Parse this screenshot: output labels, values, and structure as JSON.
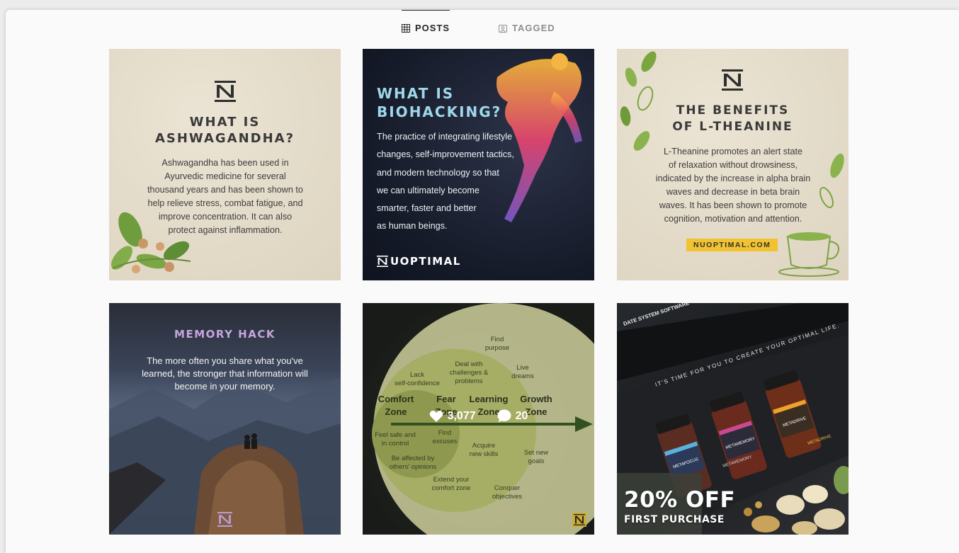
{
  "tabs": {
    "posts": "POSTS",
    "tagged": "TAGGED",
    "active": "posts",
    "active_color": "#262626",
    "inactive_color": "#8e8e8e"
  },
  "posts": [
    {
      "title_line1": "WHAT IS",
      "title_line2": "ASHWAGANDHA?",
      "body_lines": [
        "Ashwagandha has been used in",
        "Ayurvedic medicine for several",
        "thousand years and has been shown to",
        "help relieve stress, combat fatigue, and",
        "improve concentration. It can also",
        "protect against inflammation."
      ]
    },
    {
      "title_line1": "WHAT IS",
      "title_line2": "BIOHACKING?",
      "body_lines": [
        "The practice of integrating lifestyle",
        "changes, self-improvement tactics,",
        "and modern technology so that",
        "we can ultimately become",
        "smarter, faster and better",
        "as human beings."
      ],
      "brand": "UOPTIMAL"
    },
    {
      "title_line1": "THE BENEFITS",
      "title_line2": "OF L-THEANINE",
      "body_lines": [
        "L-Theanine promotes an alert state",
        "of relaxation without drowsiness,",
        "indicated by the increase in alpha brain",
        "waves and decrease in beta brain",
        "waves. It has been shown to promote",
        "cognition, motivation and attention."
      ],
      "url": "NUOPTIMAL.COM"
    },
    {
      "title": "MEMORY HACK",
      "body_lines": [
        "The more often you share what you've",
        "learned, the stronger that information will",
        "become in your memory."
      ]
    },
    {
      "zones": [
        "Comfort",
        "Zone",
        "Fear",
        "Zone",
        "Learning",
        "Zone",
        "Growth",
        "Zone"
      ],
      "labels": [
        "Find",
        "purpose",
        "Deal with",
        "challenges &",
        "problems",
        "Lack",
        "self-confidence",
        "Live",
        "dreams",
        "Feel safe and",
        "in control",
        "Find",
        "excuses",
        "Acquire",
        "new skills",
        "Set new",
        "goals",
        "Be affected by",
        "others' opinions",
        "Extend your",
        "comfort zone",
        "Conquer",
        "objectives"
      ],
      "likes": "3,077",
      "comments": "20"
    },
    {
      "tagline": "IT'S TIME FOR YOU TO CREATE YOUR OPTIMAL LIFE.",
      "header": "DATE SYSTEM SOFTWARE",
      "bottles": [
        "METAFOCUS",
        "METAMEMORY",
        "METADRIVE"
      ],
      "box_brand": "METAMEMORY",
      "box_brand2": "METADRIVE",
      "promo_big": "20% OFF",
      "promo_small": "FIRST PURCHASE"
    }
  ]
}
